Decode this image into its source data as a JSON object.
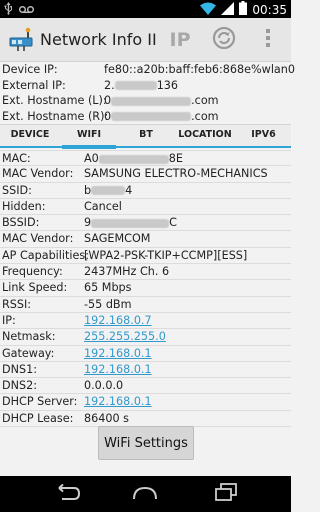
{
  "status_bar": {
    "time": "00:35",
    "left_icons": [
      "usb-icon",
      "voicemail-icon"
    ],
    "right_icons": [
      "wifi-icon",
      "signal-icon",
      "battery-icon"
    ]
  },
  "action_bar": {
    "title": "Network Info II",
    "ip_label": "IP"
  },
  "header": {
    "rows": [
      {
        "label": "Device IP:",
        "value": "fe80::a20b:baff:feb6:868e%wlan0"
      },
      {
        "label": "External IP:",
        "value_prefix": "2.",
        "value_suffix": "136"
      },
      {
        "label": "Ext. Hostname (L):",
        "value_prefix": "0",
        "value_suffix": ".com"
      },
      {
        "label": "Ext. Hostname (R):",
        "value_prefix": "0",
        "value_suffix": ".com"
      }
    ]
  },
  "tabs": [
    {
      "label": "DEVICE",
      "active": false
    },
    {
      "label": "WIFI",
      "active": true
    },
    {
      "label": "BT",
      "active": false
    },
    {
      "label": "LOCATION",
      "active": false
    },
    {
      "label": "IPV6",
      "active": false
    }
  ],
  "wifi": {
    "rows": [
      {
        "label": "MAC:",
        "value_prefix": "A0",
        "value_suffix": "8E",
        "blurred": true
      },
      {
        "label": "MAC Vendor:",
        "value": "SAMSUNG ELECTRO-MECHANICS"
      },
      {
        "label": "SSID:",
        "value_prefix": "b",
        "value_suffix": "4",
        "blurred": true
      },
      {
        "label": "Hidden:",
        "value": "Cancel"
      },
      {
        "label": "BSSID:",
        "value_prefix": "9",
        "value_suffix": "C",
        "blurred": true
      },
      {
        "label": "MAC Vendor:",
        "value": "SAGEMCOM"
      },
      {
        "label": "AP Capabilities:",
        "value": "[WPA2-PSK-TKIP+CCMP][ESS]"
      },
      {
        "label": "Frequency:",
        "value": "2437MHz Ch. 6"
      },
      {
        "label": "Link Speed:",
        "value": "65 Mbps"
      },
      {
        "label": "RSSI:",
        "value": "-55 dBm"
      },
      {
        "label": "IP:",
        "value": "192.168.0.7",
        "link": true
      },
      {
        "label": "Netmask:",
        "value": "255.255.255.0",
        "link": true
      },
      {
        "label": "Gateway:",
        "value": "192.168.0.1",
        "link": true
      },
      {
        "label": "DNS1:",
        "value": "192.168.0.1",
        "link": true
      },
      {
        "label": "DNS2:",
        "value": "0.0.0.0"
      },
      {
        "label": "DHCP Server:",
        "value": "192.168.0.1",
        "link": true
      },
      {
        "label": "DHCP Lease:",
        "value": "86400 s"
      }
    ]
  },
  "button": {
    "label": "WiFi Settings"
  },
  "colors": {
    "accent": "#2fa4d7",
    "link": "#3399cc",
    "status_bar": "#000000"
  }
}
